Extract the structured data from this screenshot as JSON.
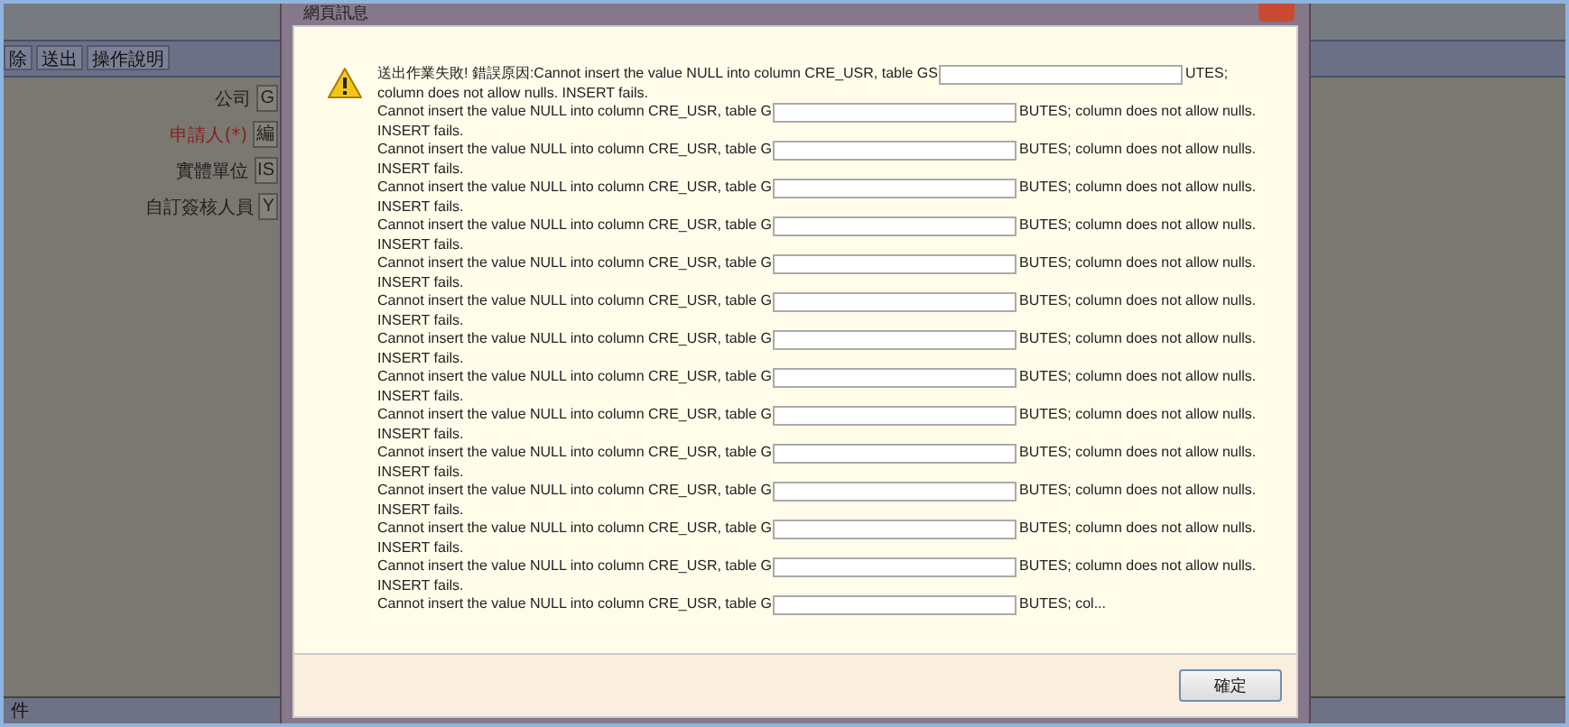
{
  "background_page": {
    "toolbar": [
      "除",
      "送出",
      "操作說明"
    ],
    "form_rows": [
      {
        "label": "公司",
        "required": false,
        "value": "G"
      },
      {
        "label": "申請人(*)",
        "required": true,
        "value": "編"
      },
      {
        "label": "實體單位",
        "required": false,
        "value": "IS"
      },
      {
        "label": "自訂簽核人員",
        "required": false,
        "value": "Y"
      }
    ],
    "status_bar": "件"
  },
  "dialog": {
    "title": "網頁訊息",
    "first_message": {
      "prefix": "送出作業失敗! 錯誤原因:Cannot insert the value NULL into column CRE_USR, table GS",
      "suffix": "UTES;",
      "continuation": "column does not allow nulls. INSERT fails."
    },
    "messages": [
      {
        "prefix": "Cannot insert the value NULL into column CRE_USR, table G",
        "suffix": "BUTES; column does not allow nulls.",
        "continuation": "INSERT fails."
      },
      {
        "prefix": "Cannot insert the value NULL into column CRE_USR, table G",
        "suffix": "BUTES; column does not allow nulls.",
        "continuation": "INSERT fails."
      },
      {
        "prefix": "Cannot insert the value NULL into column CRE_USR, table G",
        "suffix": "BUTES; column does not allow nulls.",
        "continuation": "INSERT fails."
      },
      {
        "prefix": "Cannot insert the value NULL into column CRE_USR, table G",
        "suffix": "BUTES; column does not allow nulls.",
        "continuation": "INSERT fails."
      },
      {
        "prefix": "Cannot insert the value NULL into column CRE_USR, table G",
        "suffix": "BUTES; column does not allow nulls.",
        "continuation": "INSERT fails."
      },
      {
        "prefix": "Cannot insert the value NULL into column CRE_USR, table G",
        "suffix": "BUTES; column does not allow nulls.",
        "continuation": "INSERT fails."
      },
      {
        "prefix": "Cannot insert the value NULL into column CRE_USR, table G",
        "suffix": "BUTES; column does not allow nulls.",
        "continuation": "INSERT fails."
      },
      {
        "prefix": "Cannot insert the value NULL into column CRE_USR, table G",
        "suffix": "BUTES; column does not allow nulls.",
        "continuation": "INSERT fails."
      },
      {
        "prefix": "Cannot insert the value NULL into column CRE_USR, table G",
        "suffix": "BUTES; column does not allow nulls.",
        "continuation": "INSERT fails."
      },
      {
        "prefix": "Cannot insert the value NULL into column CRE_USR, table G",
        "suffix": "BUTES; column does not allow nulls.",
        "continuation": "INSERT fails."
      },
      {
        "prefix": "Cannot insert the value NULL into column CRE_USR, table G",
        "suffix": "BUTES; column does not allow nulls.",
        "continuation": "INSERT fails."
      },
      {
        "prefix": "Cannot insert the value NULL into column CRE_USR, table G",
        "suffix": "BUTES; column does not allow nulls.",
        "continuation": "INSERT fails."
      },
      {
        "prefix": "Cannot insert the value NULL into column CRE_USR, table G",
        "suffix": "BUTES; column does not allow nulls.",
        "continuation": "INSERT fails."
      },
      {
        "prefix": "Cannot insert the value NULL into column CRE_USR, table G",
        "suffix": "BUTES; col..."
      }
    ],
    "ok_button": "確定"
  }
}
